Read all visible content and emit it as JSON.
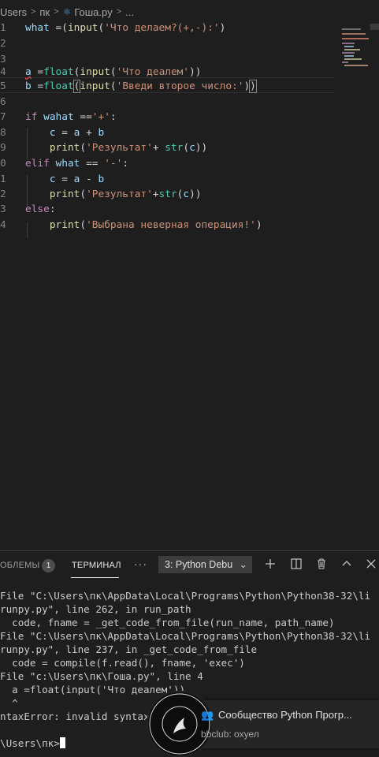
{
  "breadcrumb": {
    "seg1": "Users",
    "seg2": "пк",
    "seg3": "Гоша.py",
    "seg4": "..."
  },
  "code": {
    "lines": [
      {
        "num": "1"
      },
      {
        "num": "2"
      },
      {
        "num": "3"
      },
      {
        "num": "4"
      },
      {
        "num": "5"
      },
      {
        "num": "6"
      },
      {
        "num": "7"
      },
      {
        "num": "8"
      },
      {
        "num": "9"
      },
      {
        "num": "0"
      },
      {
        "num": "1"
      },
      {
        "num": "2"
      },
      {
        "num": "3"
      },
      {
        "num": "4"
      }
    ],
    "s_what1": "'Что делаем?(+,-):'",
    "s_a": "'Что деалем'",
    "s_b": "'Введи второе число:'",
    "s_plus": "'+'",
    "s_res1": "'Результат'",
    "s_minus": "'-'",
    "s_res2": "'Результат'",
    "s_err": "'Выбрана неверная операция!'"
  },
  "panel": {
    "problems_label": "ОБЛЕМЫ",
    "problems_count": "1",
    "terminal_label": "ТЕРМИНАЛ",
    "terminal_select": "3: Python Debu",
    "more": "···"
  },
  "terminal": {
    "lines": [
      "File \"C:\\Users\\пк\\AppData\\Local\\Programs\\Python\\Python38-32\\li",
      "runpy.py\", line 262, in run_path",
      "  code, fname = _get_code_from_file(run_name, path_name)",
      "File \"C:\\Users\\пк\\AppData\\Local\\Programs\\Python\\Python38-32\\li",
      "runpy.py\", line 237, in _get_code_from_file",
      "  code = compile(f.read(), fname, 'exec')",
      "File \"c:\\Users\\пк\\Гоша.py\", line 4",
      "  a =float(input('Что деалем'))",
      "  ^",
      "ntaxError: invalid syntax",
      "",
      "\\Users\\пк>"
    ]
  },
  "notification": {
    "title": "Сообщество Python Прогр...",
    "subtitle": "bbclub: охуел"
  },
  "colors": {
    "background": "#1e1e1e",
    "keyword": "#c586c0",
    "function": "#dcdcaa",
    "builtin": "#4ec9b0",
    "string": "#ce9178",
    "variable": "#9cdcfe"
  }
}
